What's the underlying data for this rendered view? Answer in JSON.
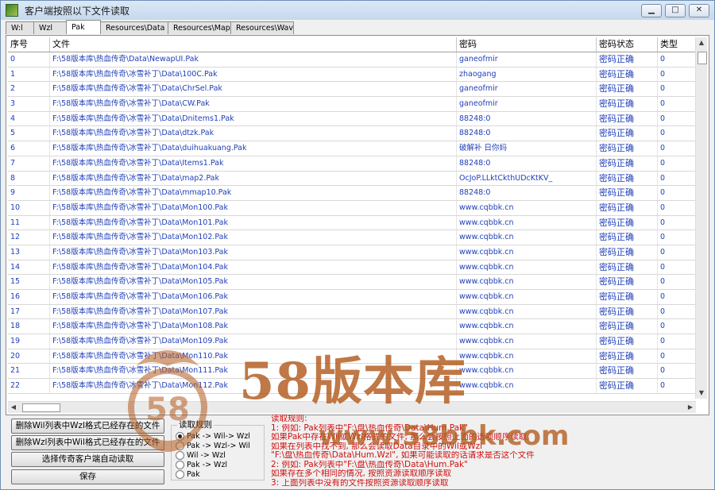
{
  "window": {
    "title": "客户端按照以下文件读取"
  },
  "tabs": [
    "W:l",
    "Wzl",
    "Pak",
    "Resources\\Data",
    "Resources\\Map",
    "Resources\\Wav"
  ],
  "active_tab": 2,
  "columns": [
    "序号",
    "文件",
    "密码",
    "密码状态",
    "类型"
  ],
  "rows": [
    [
      "0",
      "F:\\58版本库\\热血传奇\\Data\\NewapUI.Pak",
      "ganeofmir",
      "密码正确",
      "0"
    ],
    [
      "1",
      "F:\\58版本库\\热血传奇\\冰雪补丁\\Data\\100C.Pak",
      "zhaogang",
      "密码正确",
      "0"
    ],
    [
      "2",
      "F:\\58版本库\\热血传奇\\冰雪补丁\\Data\\ChrSel.Pak",
      "ganeofmir",
      "密码正确",
      "0"
    ],
    [
      "3",
      "F:\\58版本库\\热血传奇\\冰雪补丁\\Data\\CW.Pak",
      "ganeofmir",
      "密码正确",
      "0"
    ],
    [
      "4",
      "F:\\58版本库\\热血传奇\\冰雪补丁\\Data\\Dnitems1.Pak",
      "88248:0",
      "密码正确",
      "0"
    ],
    [
      "5",
      "F:\\58版本库\\热血传奇\\冰雪补丁\\Data\\dtzk.Pak",
      "88248:0",
      "密码正确",
      "0"
    ],
    [
      "6",
      "F:\\58版本库\\热血传奇\\冰雪补丁\\Data\\duihuakuang.Pak",
      "破解补 日你妈",
      "密码正确",
      "0"
    ],
    [
      "7",
      "F:\\58版本库\\热血传奇\\冰雪补丁\\Data\\Items1.Pak",
      "88248:0",
      "密码正确",
      "0"
    ],
    [
      "8",
      "F:\\58版本库\\热血传奇\\冰雪补丁\\Data\\map2.Pak",
      "OcJoP.LLktCkthUDcKtKV_",
      "密码正确",
      "0"
    ],
    [
      "9",
      "F:\\58版本库\\热血传奇\\冰雪补丁\\Data\\mmap10.Pak",
      "88248:0",
      "密码正确",
      "0"
    ],
    [
      "10",
      "F:\\58版本库\\热血传奇\\冰雪补丁\\Data\\Mon100.Pak",
      "www.cqbbk.cn",
      "密码正确",
      "0"
    ],
    [
      "11",
      "F:\\58版本库\\热血传奇\\冰雪补丁\\Data\\Mon101.Pak",
      "www.cqbbk.cn",
      "密码正确",
      "0"
    ],
    [
      "12",
      "F:\\58版本库\\热血传奇\\冰雪补丁\\Data\\Mon102.Pak",
      "www.cqbbk.cn",
      "密码正确",
      "0"
    ],
    [
      "13",
      "F:\\58版本库\\热血传奇\\冰雪补丁\\Data\\Mon103.Pak",
      "www.cqbbk.cn",
      "密码正确",
      "0"
    ],
    [
      "14",
      "F:\\58版本库\\热血传奇\\冰雪补丁\\Data\\Mon104.Pak",
      "www.cqbbk.cn",
      "密码正确",
      "0"
    ],
    [
      "15",
      "F:\\58版本库\\热血传奇\\冰雪补丁\\Data\\Mon105.Pak",
      "www.cqbbk.cn",
      "密码正确",
      "0"
    ],
    [
      "16",
      "F:\\58版本库\\热血传奇\\冰雪补丁\\Data\\Mon106.Pak",
      "www.cqbbk.cn",
      "密码正确",
      "0"
    ],
    [
      "17",
      "F:\\58版本库\\热血传奇\\冰雪补丁\\Data\\Mon107.Pak",
      "www.cqbbk.cn",
      "密码正确",
      "0"
    ],
    [
      "18",
      "F:\\58版本库\\热血传奇\\冰雪补丁\\Data\\Mon108.Pak",
      "www.cqbbk.cn",
      "密码正确",
      "0"
    ],
    [
      "19",
      "F:\\58版本库\\热血传奇\\冰雪补丁\\Data\\Mon109.Pak",
      "www.cqbbk.cn",
      "密码正确",
      "0"
    ],
    [
      "20",
      "F:\\58版本库\\热血传奇\\冰雪补丁\\Data\\Mon110.Pak",
      "www.cqbbk.cn",
      "密码正确",
      "0"
    ],
    [
      "21",
      "F:\\58版本库\\热血传奇\\冰雪补丁\\Data\\Mon111.Pak",
      "www.cqbbk.cn",
      "密码正确",
      "0"
    ],
    [
      "22",
      "F:\\58版本库\\热血传奇\\冰雪补丁\\Data\\Mon112.Pak",
      "www.cqbbk.cn",
      "密码正确",
      "0"
    ]
  ],
  "buttons": {
    "del_wil": "删除Wil列表中Wzl格式已经存在的文件",
    "del_wzl": "删除Wzl列表中Wil格式已经存在的文件",
    "auto_read": "选择传奇客户端自动读取",
    "save": "保存"
  },
  "radio": {
    "legend": "读取规则",
    "options": [
      "Pak -> Wil-> Wzl",
      "Pak -> Wzl-> Wil",
      "Wil -> Wzl",
      "Pak -> Wzl",
      "Pak"
    ],
    "selected": 0
  },
  "rules": [
    "读取规则:",
    "1: 例如: Pak列表中\"F:\\盘\\热血传奇\\Data\\Hum.Pak\"",
    "   如果Pak中存在Wil或Wzl格式的文件, 那么会按照上面的选项顺序读取,",
    "   如果在列表中找不到, 那么会读取Data目录中的Wil或Wzl",
    "   \"F:\\盘\\热血传奇\\Data\\Hum.Wzl\", 如果可能读取的话请求是否这个文件",
    "2: 例如: Pak列表中\"F:\\盘\\热血传奇\\Data\\Hum.Pak\"",
    "   如果存在多个相同的情况, 按照资源读取顺序读取",
    "3: 上面列表中没有的文件按照资源读取顺序读取"
  ],
  "watermark": {
    "main": "58版本库",
    "url": "www.58bbk.com",
    "logo": "58"
  }
}
